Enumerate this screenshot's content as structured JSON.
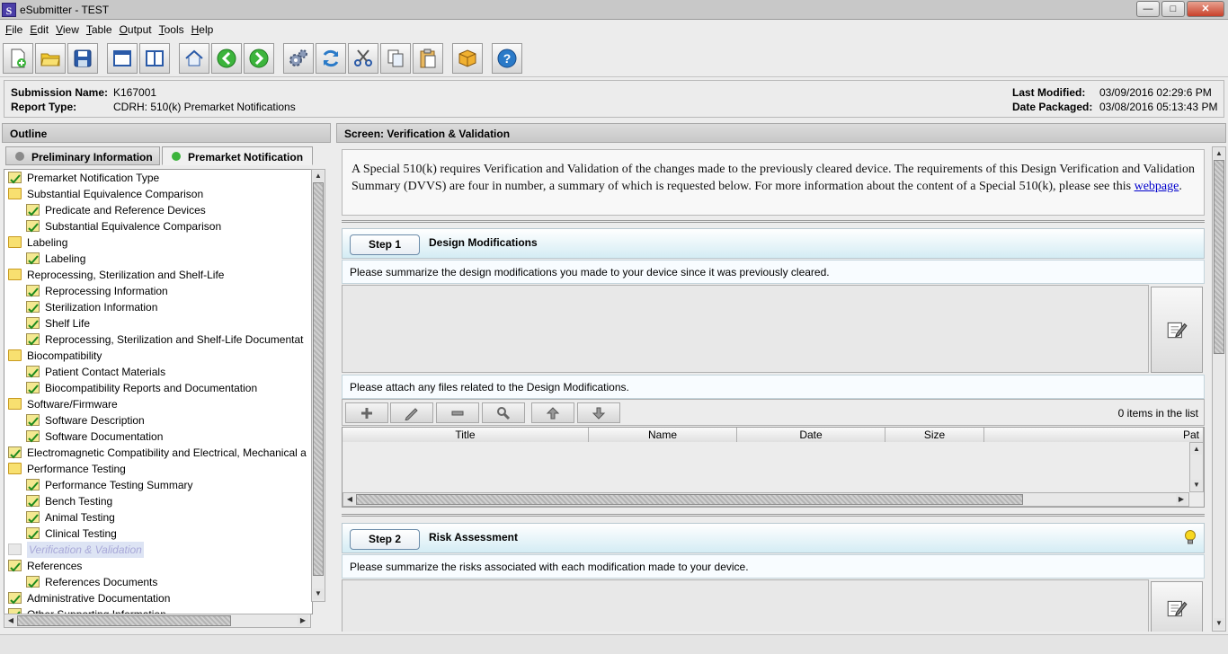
{
  "window": {
    "title": "eSubmitter - TEST",
    "controls": [
      "minimize",
      "maximize",
      "close"
    ]
  },
  "menu": [
    "File",
    "Edit",
    "View",
    "Table",
    "Output",
    "Tools",
    "Help"
  ],
  "toolbar": {
    "buttons": [
      "new-doc-icon",
      "open-folder-icon",
      "save-icon",
      "window-icon",
      "split-icon",
      "home-icon",
      "back-arrow-icon",
      "forward-arrow-icon",
      "gears-icon",
      "refresh-icon",
      "cut-icon",
      "copy-icon",
      "paste-icon",
      "package-icon",
      "help-icon"
    ]
  },
  "info": {
    "submission_name_label": "Submission Name:",
    "submission_name": "K167001",
    "report_type_label": "Report Type:",
    "report_type": "CDRH: 510(k) Premarket Notifications",
    "last_modified_label": "Last Modified:",
    "last_modified": "03/09/2016 02:29:6 PM",
    "date_packaged_label": "Date Packaged:",
    "date_packaged": "03/08/2016 05:13:43 PM"
  },
  "outline": {
    "header": "Outline",
    "tabs": [
      {
        "label": "Preliminary Information",
        "status_color": "#8a8a8a"
      },
      {
        "label": "Premarket Notification",
        "status_color": "#3cb43c"
      }
    ],
    "tree": [
      {
        "label": "Premarket Notification Type",
        "level": 0,
        "icon": "check"
      },
      {
        "label": "Substantial Equivalence Comparison",
        "level": 0,
        "icon": "folder"
      },
      {
        "label": "Predicate and Reference Devices",
        "level": 1,
        "icon": "check"
      },
      {
        "label": "Substantial Equivalence Comparison",
        "level": 1,
        "icon": "check"
      },
      {
        "label": "Labeling",
        "level": 0,
        "icon": "folder"
      },
      {
        "label": "Labeling",
        "level": 1,
        "icon": "check"
      },
      {
        "label": "Reprocessing, Sterilization and Shelf-Life",
        "level": 0,
        "icon": "folder"
      },
      {
        "label": "Reprocessing Information",
        "level": 1,
        "icon": "check"
      },
      {
        "label": "Sterilization Information",
        "level": 1,
        "icon": "check"
      },
      {
        "label": "Shelf Life",
        "level": 1,
        "icon": "check"
      },
      {
        "label": "Reprocessing, Sterilization and Shelf-Life Documentat",
        "level": 1,
        "icon": "check"
      },
      {
        "label": "Biocompatibility",
        "level": 0,
        "icon": "folder"
      },
      {
        "label": "Patient Contact Materials",
        "level": 1,
        "icon": "check"
      },
      {
        "label": "Biocompatibility Reports and Documentation",
        "level": 1,
        "icon": "check"
      },
      {
        "label": "Software/Firmware",
        "level": 0,
        "icon": "folder"
      },
      {
        "label": "Software Description",
        "level": 1,
        "icon": "check"
      },
      {
        "label": "Software Documentation",
        "level": 1,
        "icon": "check"
      },
      {
        "label": "Electromagnetic Compatibility and Electrical, Mechanical a",
        "level": 0,
        "icon": "check"
      },
      {
        "label": "Performance Testing",
        "level": 0,
        "icon": "folder"
      },
      {
        "label": "Performance Testing Summary",
        "level": 1,
        "icon": "check"
      },
      {
        "label": "Bench Testing",
        "level": 1,
        "icon": "check"
      },
      {
        "label": "Animal Testing",
        "level": 1,
        "icon": "check"
      },
      {
        "label": "Clinical Testing",
        "level": 1,
        "icon": "check"
      },
      {
        "label": "Verification & Validation",
        "level": 0,
        "icon": "disabled-folder",
        "disabled": true
      },
      {
        "label": "References",
        "level": 0,
        "icon": "check"
      },
      {
        "label": "References Documents",
        "level": 1,
        "icon": "check"
      },
      {
        "label": "Administrative Documentation",
        "level": 0,
        "icon": "check"
      },
      {
        "label": "Other Supporting Information",
        "level": 0,
        "icon": "check"
      }
    ]
  },
  "screen": {
    "header": "Screen: Verification & Validation",
    "intro_text": "A Special 510(k) requires Verification and Validation of the changes made to the previously cleared device. The requirements of this Design Verification and Validation Summary (DVVS) are four in number, a summary of which is requested below. For more information about the content of a Special 510(k), please see this ",
    "intro_link": "webpage",
    "intro_end": ".",
    "steps": [
      {
        "button": "Step 1",
        "title": "Design Modifications",
        "prompt": "Please summarize the design modifications you made to your device since it was previously cleared.",
        "attach_prompt": "Please attach any files related to the Design Modifications.",
        "items_count": "0 items in the list",
        "columns": [
          "Title",
          "Name",
          "Date",
          "Size",
          "Pat"
        ]
      },
      {
        "button": "Step 2",
        "title": "Risk Assessment",
        "prompt": "Please summarize the risks associated with each modification made to your device."
      }
    ]
  }
}
